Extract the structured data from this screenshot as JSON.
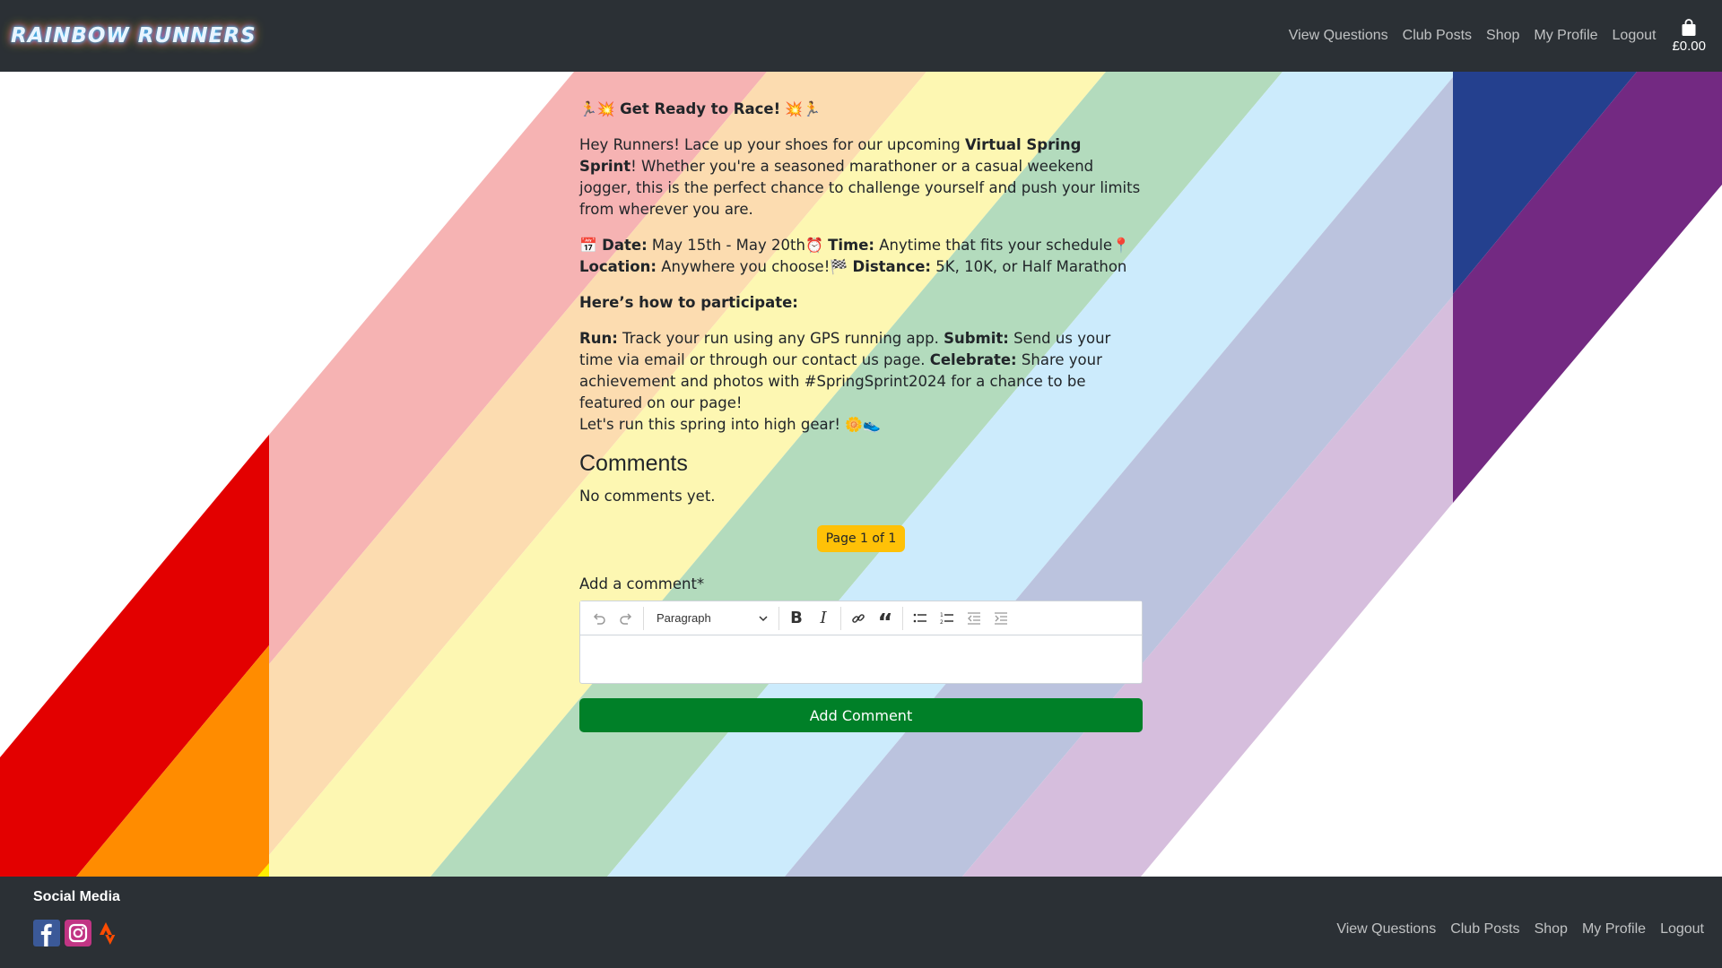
{
  "header": {
    "brand": "RAINBOW RUNNERS",
    "nav": [
      "View Questions",
      "Club Posts",
      "Shop",
      "My Profile",
      "Logout"
    ],
    "basket_total": "£0.00"
  },
  "post": {
    "heading_emoji_left": "🏃💥",
    "heading": "Get Ready to Race!",
    "heading_emoji_right": "💥🏃",
    "intro_1": "Hey Runners! Lace up your shoes for our upcoming ",
    "intro_bold": "Virtual Spring Sprint",
    "intro_2": "! Whether you're a seasoned marathoner or a casual weekend jogger, this is the perfect chance to challenge yourself and push your limits from wherever you are.",
    "date_emoji": "📅",
    "date_label": "Date:",
    "date_value": " May 15th - May 20th",
    "time_emoji": "⏰",
    "time_label": "Time:",
    "time_value": " Anytime that fits your schedule",
    "location_emoji": "📍",
    "location_label": "Location:",
    "location_value": " Anywhere you choose!",
    "distance_emoji": "🏁",
    "distance_label": "Distance:",
    "distance_value": " 5K, 10K, or Half Marathon",
    "how_heading": "Here’s how to participate:",
    "run_label": "Run:",
    "run_value": " Track your run using any GPS running app. ",
    "submit_label": "Submit:",
    "submit_value": " Send us your time via email or through our contact us page. ",
    "celebrate_label": "Celebrate:",
    "celebrate_value": " Share your achievement and photos with #SpringSprint2024 for a chance to be featured on our page!",
    "closing": "Let's run this spring into high gear! ",
    "closing_emoji": "🌼👟"
  },
  "comments": {
    "title": "Comments",
    "empty_text": "No comments yet.",
    "pagination": "Page 1 of 1",
    "add_label": "Add a comment*",
    "editor_paragraph": "Paragraph",
    "submit_button": "Add Comment"
  },
  "footer": {
    "social_title": "Social Media",
    "social": [
      "facebook-icon",
      "instagram-icon",
      "strava-icon"
    ],
    "nav": [
      "View Questions",
      "Club Posts",
      "Shop",
      "My Profile",
      "Logout"
    ]
  },
  "colors": {
    "navbar": "#2b3035",
    "accent_button": "#008028",
    "badge": "#ffc107",
    "rainbow": [
      "#e30000",
      "#ff8c00",
      "#ffef00",
      "#008121",
      "#00c0ff",
      "#1e3a8a",
      "#762a86"
    ]
  }
}
